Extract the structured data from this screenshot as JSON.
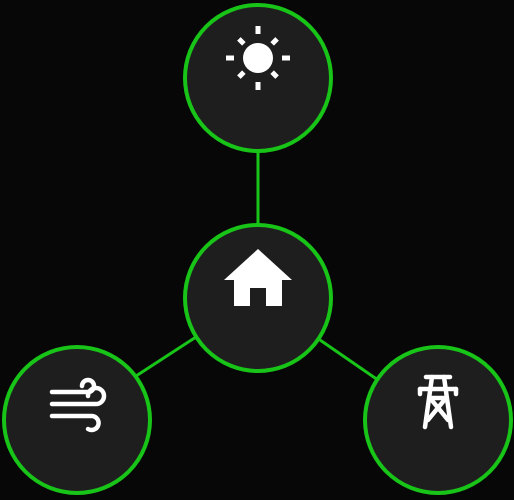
{
  "diagram": {
    "nodes": [
      {
        "id": "solar",
        "icon": "sun-icon"
      },
      {
        "id": "home",
        "icon": "home-icon"
      },
      {
        "id": "wind",
        "icon": "wind-icon"
      },
      {
        "id": "grid",
        "icon": "power-tower-icon"
      }
    ],
    "edges": [
      {
        "from": "solar",
        "to": "home"
      },
      {
        "from": "wind",
        "to": "home"
      },
      {
        "from": "grid",
        "to": "home"
      }
    ]
  },
  "colors": {
    "background": "#070707",
    "node_fill": "#1e1e1e",
    "node_stroke": "#18c418",
    "connector": "#18c418",
    "icon": "#ffffff"
  }
}
